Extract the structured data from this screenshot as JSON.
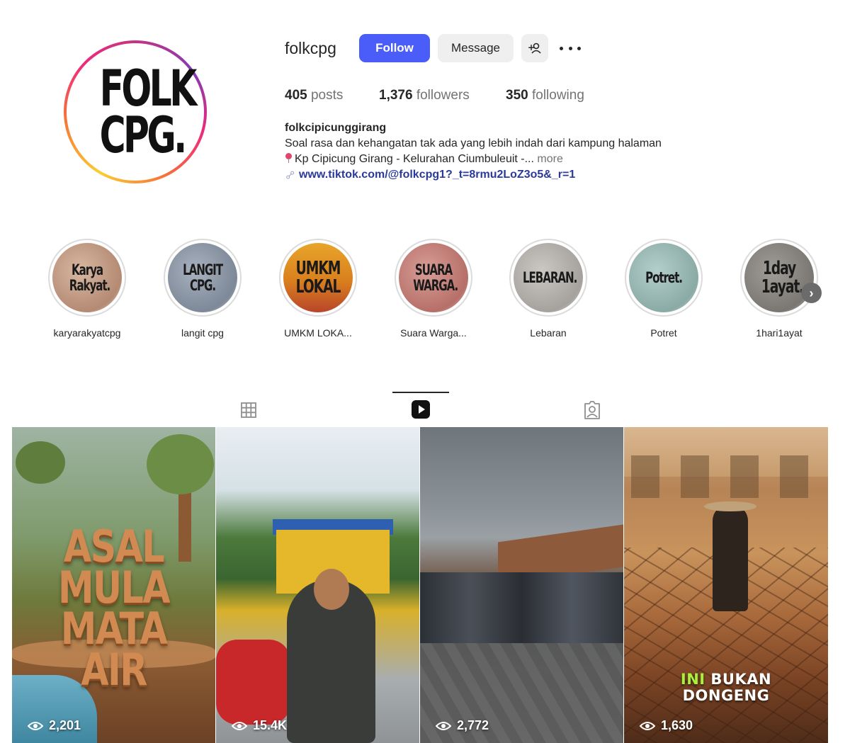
{
  "profile": {
    "username": "folkcpg",
    "avatar_text": "FOLK CPG.",
    "follow_label": "Follow",
    "message_label": "Message",
    "adduser_glyph": "+",
    "stats": {
      "posts_count": "405",
      "posts_label": " posts",
      "followers_count": "1,376",
      "followers_label": " followers",
      "following_count": "350",
      "following_label": " following"
    },
    "bio": {
      "name": "folkcipicunggirang",
      "line1": "Soal rasa dan kehangatan tak ada yang lebih indah dari kampung halaman",
      "line2": "Kp Cipicung Girang - Kelurahan Ciumbuleuit -...",
      "more": " more",
      "link": "www.tiktok.com/@folkcpg1?_t=8rmu2LoZ3o5&_r=1"
    }
  },
  "highlights": [
    {
      "text": "Karya Rakyat.",
      "label": "karyarakyatcpg",
      "bg": "#c9a48f"
    },
    {
      "text": "LANGIT CPG.",
      "label": "langit cpg",
      "bg": "#8f9aa8"
    },
    {
      "text": "UMKM LOKAL",
      "label": "UMKM LOKA...",
      "bg": "#d98a22"
    },
    {
      "text": "SUARA WARGA.",
      "label": "Suara Warga...",
      "bg": "#c98a84"
    },
    {
      "text": "LEBARAN.",
      "label": "Lebaran",
      "bg": "#b9b6b2"
    },
    {
      "text": "Potret.",
      "label": "Potret",
      "bg": "#9fbcb8"
    },
    {
      "text": "1day 1ayat.",
      "label": "1hari1ayat",
      "bg": "#8a8682"
    }
  ],
  "tabs": [
    "grid-icon",
    "reels-icon",
    "tagged-icon"
  ],
  "reels": [
    {
      "title": "ASAL MULA MATA AIR",
      "views": "2,201"
    },
    {
      "title": "",
      "views": "15.4K"
    },
    {
      "title": "",
      "views": "2,772"
    },
    {
      "title_a": "INI",
      "title_b": " BUKAN",
      "title_c": "DONGENG",
      "views": "1,630"
    }
  ],
  "colors": {
    "follow_button": "#4a5df9",
    "secondary_button": "#efefef",
    "link": "#2a3a9a",
    "muted_text": "#737373"
  }
}
